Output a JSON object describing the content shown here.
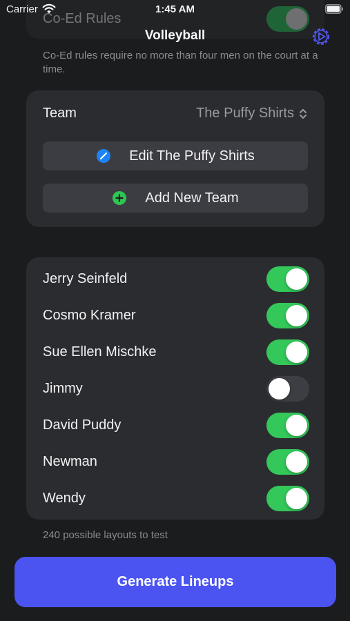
{
  "status_bar": {
    "carrier": "Carrier",
    "time": "1:45 AM"
  },
  "nav": {
    "title": "Volleyball"
  },
  "coed": {
    "title": "Co-Ed Rules",
    "enabled": true,
    "footer": "Co-Ed rules require no more than four men on the court at a time."
  },
  "team": {
    "label": "Team",
    "selected": "The Puffy Shirts",
    "edit_label": "Edit The Puffy Shirts",
    "add_label": "Add New Team"
  },
  "players": [
    {
      "name": "Jerry Seinfeld",
      "active": true
    },
    {
      "name": "Cosmo Kramer",
      "active": true
    },
    {
      "name": "Sue Ellen Mischke",
      "active": true
    },
    {
      "name": "Jimmy",
      "active": false
    },
    {
      "name": "David Puddy",
      "active": true
    },
    {
      "name": "Newman",
      "active": true
    },
    {
      "name": "Wendy",
      "active": true
    }
  ],
  "layouts_text": "240 possible layouts to test",
  "generate_label": "Generate Lineups",
  "colors": {
    "accent": "#4b54f1",
    "toggle_on": "#34c759",
    "toggle_off": "#3d3e43",
    "card": "#2b2c30",
    "background": "#1b1c1e"
  },
  "icons": {
    "settings": "settings-play-icon",
    "edit": "pencil-circle-icon",
    "add": "plus-circle-icon"
  }
}
